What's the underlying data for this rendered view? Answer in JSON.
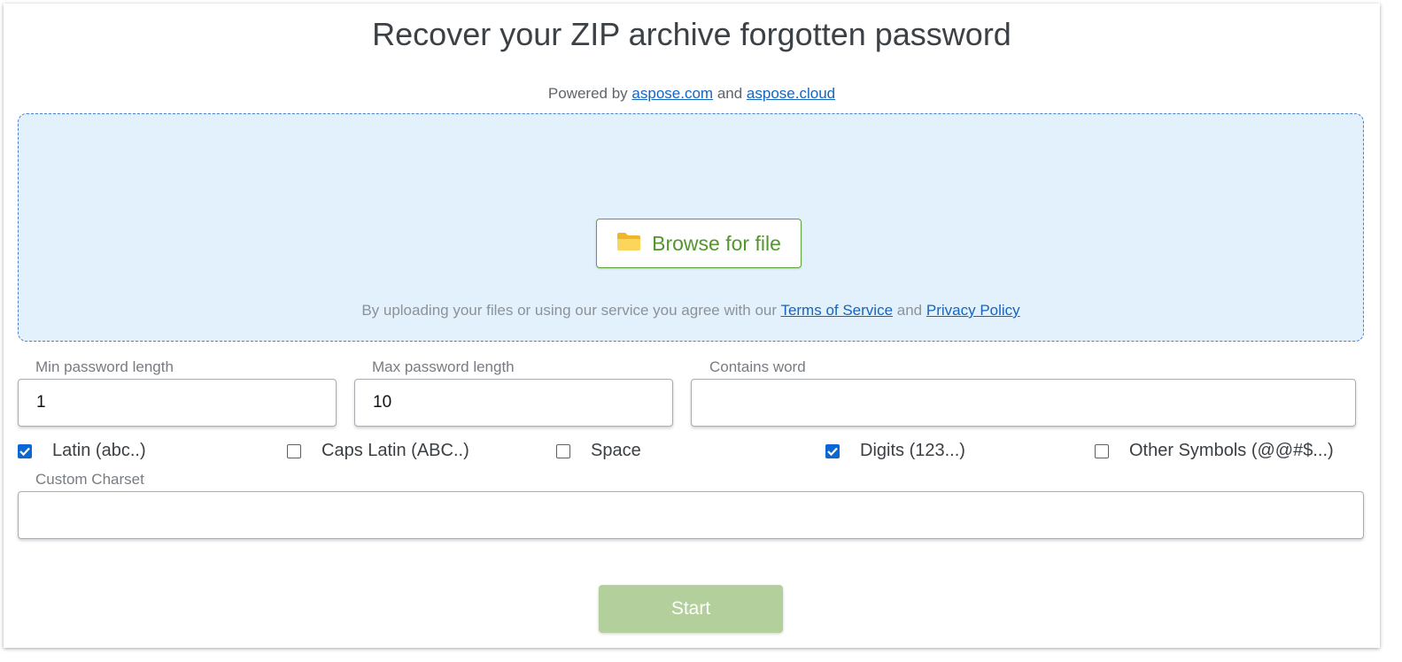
{
  "page": {
    "title": "Recover your ZIP archive forgotten password",
    "powered_prefix": "Powered by",
    "powered_link1": "aspose.com",
    "powered_and": "and",
    "powered_link2": "aspose.cloud"
  },
  "upload": {
    "browse_label": "Browse for file",
    "terms_prefix": "By uploading your files or using our service you agree with our",
    "terms_link": "Terms of Service",
    "terms_and": "and",
    "privacy_link": "Privacy Policy"
  },
  "fields": {
    "min_label": "Min password length",
    "min_value": "1",
    "max_label": "Max password length",
    "max_value": "10",
    "word_label": "Contains word",
    "word_value": "",
    "charset_label": "Custom Charset",
    "charset_value": ""
  },
  "charsets": [
    {
      "label": "Latin (abc..)",
      "checked": true
    },
    {
      "label": "Caps Latin (ABC..)",
      "checked": false
    },
    {
      "label": "Space",
      "checked": false
    },
    {
      "label": "Digits (123...)",
      "checked": true
    },
    {
      "label": "Other Symbols (@@#$...)",
      "checked": false
    }
  ],
  "actions": {
    "start_label": "Start"
  },
  "colors": {
    "dropzone_bg": "#e3f1fc",
    "browse_text": "#54962d",
    "start_bg": "#b3d09c",
    "checkbox_checked": "#0b67d3",
    "link": "#1565c0"
  },
  "icons": {
    "browse": "folder-icon",
    "checked": "checkmark-icon"
  }
}
